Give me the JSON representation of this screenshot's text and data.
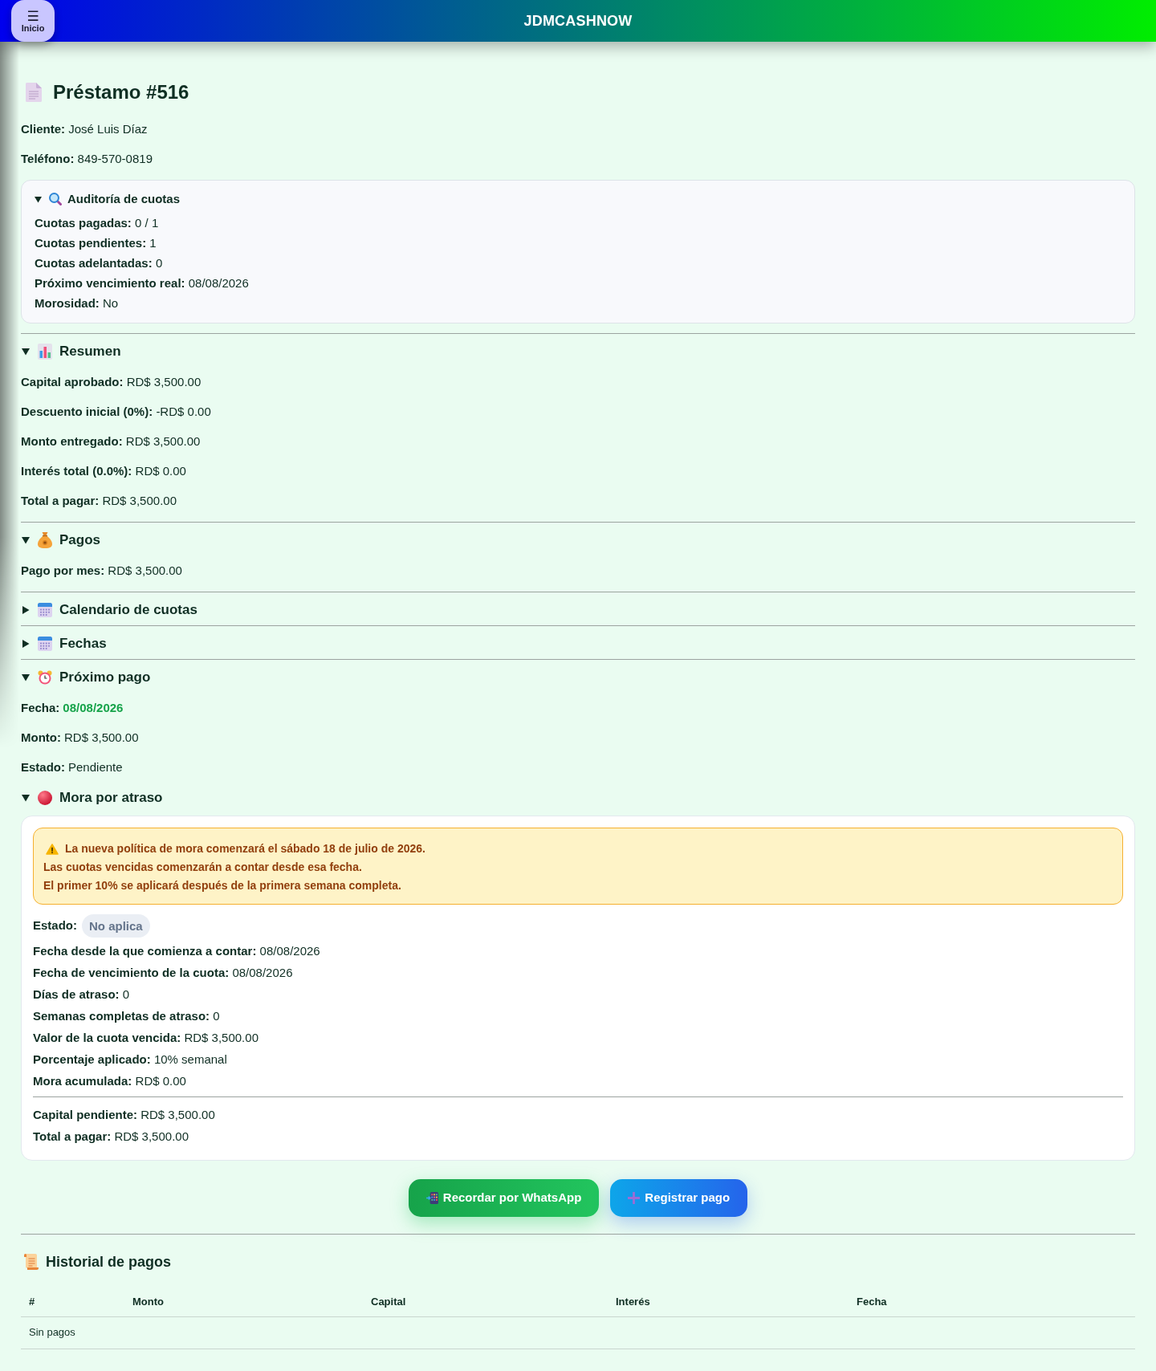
{
  "header": {
    "menu_button": {
      "icon": "☰",
      "label": "Inicio"
    },
    "brand": "JDMCASHNOW"
  },
  "loan": {
    "title": "Préstamo #516",
    "details": [
      {
        "label": "Cliente:",
        "value": "José Luis Díaz"
      },
      {
        "label": "Teléfono:",
        "value": "849-570-0819"
      }
    ]
  },
  "sections": [
    {
      "kind": "audit",
      "title": "Auditoría de cuotas",
      "expanded": true,
      "fields": [
        {
          "label": "Cuotas pagadas:",
          "value": "0 / 1"
        },
        {
          "label": "Cuotas pendientes:",
          "value": "1"
        },
        {
          "label": "Cuotas adelantadas:",
          "value": "0"
        },
        {
          "label": "Próximo vencimiento real:",
          "value": "08/08/2026"
        },
        {
          "label": "Morosidad:",
          "value": "No"
        }
      ]
    },
    {
      "kind": "summary",
      "title": "Resumen",
      "expanded": true,
      "fields": [
        {
          "label": "Capital aprobado:",
          "value": "RD$ 3,500.00"
        },
        {
          "label": "Descuento inicial (0%):",
          "value": "-RD$ 0.00"
        },
        {
          "label": "Monto entregado:",
          "value": "RD$ 3,500.00"
        },
        {
          "label": "Interés total (0.0%):",
          "value": "RD$ 0.00"
        },
        {
          "label": "Total a pagar:",
          "value": "RD$ 3,500.00"
        }
      ]
    },
    {
      "kind": "payments",
      "title": "Pagos",
      "expanded": true,
      "fields": [
        {
          "label": "Pago por mes:",
          "value": "RD$ 3,500.00"
        }
      ]
    },
    {
      "kind": "schedule",
      "title": "Calendario de cuotas",
      "expanded": false
    },
    {
      "kind": "dates",
      "title": "Fechas",
      "expanded": false
    },
    {
      "kind": "next_payment",
      "title": "Próximo pago",
      "expanded": true,
      "fields": [
        {
          "label": "Fecha:",
          "value": "08/08/2026",
          "highlighted": true
        },
        {
          "label": "Monto:",
          "value": "RD$ 3,500.00",
          "highlighted": false
        },
        {
          "label": "Estado:",
          "value": "Pendiente",
          "highlighted": false
        }
      ]
    },
    {
      "kind": "late_fee",
      "title": "Mora por atraso",
      "expanded": true,
      "notice": [
        "La nueva política de mora comenzará el sábado 18 de julio de 2026.",
        "Las cuotas vencidas comenzarán a contar desde esa fecha.",
        "El primer 10% se aplicará después de la primera semana completa."
      ],
      "status": {
        "label": "Estado:",
        "badge": "No aplica"
      },
      "fields": [
        {
          "label": "Fecha desde la que comienza a contar:",
          "value": "08/08/2026"
        },
        {
          "label": "Fecha de vencimiento de la cuota:",
          "value": "08/08/2026"
        },
        {
          "label": "Días de atraso:",
          "value": "0"
        },
        {
          "label": "Semanas completas de atraso:",
          "value": "0"
        },
        {
          "label": "Valor de la cuota vencida:",
          "value": "RD$ 3,500.00"
        },
        {
          "label": "Porcentaje aplicado:",
          "value": "10% semanal"
        },
        {
          "label": "Mora acumulada:",
          "value": "RD$ 0.00"
        }
      ],
      "totals": [
        {
          "label": "Capital pendiente:",
          "value": "RD$ 3,500.00"
        },
        {
          "label": "Total a pagar:",
          "value": "RD$ 3,500.00"
        }
      ]
    }
  ],
  "actions": [
    {
      "kind": "whatsapp",
      "label": "Recordar por WhatsApp"
    },
    {
      "kind": "register",
      "label": "Registrar pago"
    }
  ],
  "history": {
    "title": "Historial de pagos",
    "columns": [
      "#",
      "Monto",
      "Capital",
      "Interés",
      "Fecha"
    ],
    "empty_text": "Sin pagos"
  }
}
